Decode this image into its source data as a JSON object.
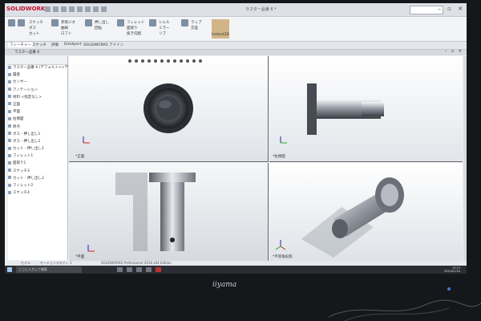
{
  "app": {
    "logo": "SOLIDWORKS",
    "title": "ラスター品番 6 *"
  },
  "ribbon": {
    "labels": [
      "スケッチ",
      "ボス",
      "カット",
      "参照ジオ",
      "曲線",
      "ロフト",
      "押し出し",
      "回転",
      "フィレット",
      "面取り",
      "抜き勾配",
      "シェル",
      "ミラー",
      "リブ",
      "ラップ",
      "交差",
      "Instant3D"
    ]
  },
  "command_tabs": [
    "フィーチャー",
    "スケッチ",
    "評価",
    "DimXpert",
    "SOLIDWORKS アドイン"
  ],
  "document": {
    "title": "ラスター品番 6"
  },
  "tree": {
    "items": [
      "ラスター品番 6 (デフォルト<<デフォルト>_表示状態",
      "履歴",
      "センサー",
      "アノテーション",
      "材料 <指定なし>",
      "正面",
      "平面",
      "右側面",
      "原点",
      "ボス - 押し出し1",
      "ボス - 押し出し2",
      "カット - 押し出し1",
      "フィレット1",
      "面取り1",
      "スケッチ3",
      "カット - 押し出し2",
      "フィレット2",
      "スケッチ4"
    ]
  },
  "views": [
    {
      "label": "*正面"
    },
    {
      "label": "*右側面"
    },
    {
      "label": "*平面"
    },
    {
      "label": "*不等角投影"
    }
  ],
  "status": {
    "left": "SOLIDWORKS Professional 2016 x64 Edition",
    "tab_model": "モデル",
    "tab_motion": "モーションスタディ 1"
  },
  "taskbar": {
    "search_placeholder": "ここに入力して検索",
    "time": "13:23",
    "date": "2020/01/16"
  },
  "monitor": {
    "brand": "iiyama"
  },
  "colors": {
    "accent": "#c8102e",
    "taskbar": "#2a2d33",
    "viewport_bg": "#ffffff"
  }
}
